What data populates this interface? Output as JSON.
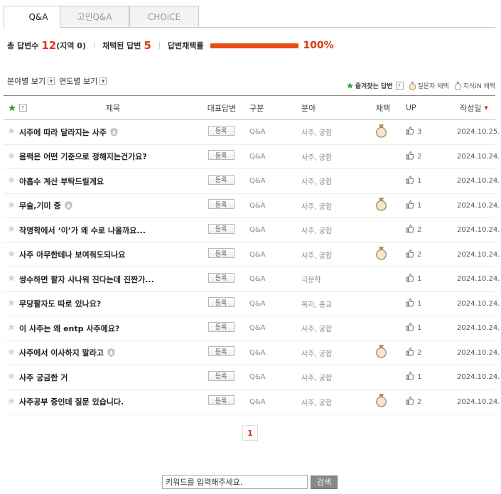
{
  "tabs": [
    {
      "label": "Q&A",
      "active": true
    },
    {
      "label": "고민Q&A",
      "active": false
    },
    {
      "label": "CHOiCE",
      "active": false
    }
  ],
  "summary": {
    "total_label": "총 답변수",
    "total_value": "12",
    "region_text": "(지역 0)",
    "chosen_label": "채택된 답변",
    "chosen_value": "5",
    "rate_label": "답변채택률",
    "rate_progress": 1.0,
    "rate_value": "100%"
  },
  "filters": [
    {
      "label": "분야별 보기"
    },
    {
      "label": "연도별 보기"
    }
  ],
  "legend": {
    "favorite": "즐겨찾는 답변",
    "help": "?",
    "questioner": "질문자 채택",
    "jisikin": "지식iN 채택"
  },
  "columns": {
    "help": "?",
    "title": "제목",
    "rep": "대표답변",
    "type": "구분",
    "category": "분야",
    "chosen": "채택",
    "up": "UP",
    "date": "작성일"
  },
  "register_label": "등록",
  "rows": [
    {
      "title": "시주에 따라 달라지는 사주",
      "lock": true,
      "type": "Q&A",
      "category": "사주, 궁합",
      "chosen": true,
      "up": "3",
      "date": "2024.10.25."
    },
    {
      "title": "음력은 어떤 기준으로 정해지는건가요?",
      "lock": false,
      "type": "Q&A",
      "category": "사주, 궁합",
      "chosen": false,
      "up": "2",
      "date": "2024.10.24."
    },
    {
      "title": "아홉수 계산 부탁드릴게요",
      "lock": false,
      "type": "Q&A",
      "category": "사주, 궁합",
      "chosen": false,
      "up": "1",
      "date": "2024.10.24."
    },
    {
      "title": "무술,기미 중",
      "lock": true,
      "type": "Q&A",
      "category": "사주, 궁합",
      "chosen": true,
      "up": "1",
      "date": "2024.10.24."
    },
    {
      "title": "작명학에서 ‘이’가 왜 수로 나올까요...",
      "lock": false,
      "type": "Q&A",
      "category": "사주, 궁합",
      "chosen": false,
      "up": "2",
      "date": "2024.10.24."
    },
    {
      "title": "사주 아무한테나 보여줘도되나요",
      "lock": false,
      "type": "Q&A",
      "category": "사주, 궁합",
      "chosen": true,
      "up": "2",
      "date": "2024.10.24."
    },
    {
      "title": "쌍수하면 팔자 사나워 진다는데 진짠가...",
      "lock": false,
      "type": "Q&A",
      "category": "극문학",
      "chosen": false,
      "up": "1",
      "date": "2024.10.24."
    },
    {
      "title": "무당팔자도 따로 있나요?",
      "lock": false,
      "type": "Q&A",
      "category": "복지, 종교",
      "chosen": false,
      "up": "1",
      "date": "2024.10.24."
    },
    {
      "title": "이 사주는 왜 entp 사주에요?",
      "lock": false,
      "type": "Q&A",
      "category": "사주, 궁합",
      "chosen": false,
      "up": "1",
      "date": "2024.10.24."
    },
    {
      "title": "사주에서 이사하지 말라고",
      "lock": true,
      "type": "Q&A",
      "category": "사주, 궁합",
      "chosen": true,
      "up": "2",
      "date": "2024.10.24."
    },
    {
      "title": "사주 궁금한 거",
      "lock": false,
      "type": "Q&A",
      "category": "사주, 궁합",
      "chosen": false,
      "up": "1",
      "date": "2024.10.24."
    },
    {
      "title": "사주공부 중인데 질문 있습니다.",
      "lock": false,
      "type": "Q&A",
      "category": "사주, 궁합",
      "chosen": true,
      "up": "2",
      "date": "2024.10.24."
    }
  ],
  "pagination": {
    "current": "1"
  },
  "search": {
    "placeholder": "키워드를 입력해주세요.",
    "button": "검색"
  }
}
